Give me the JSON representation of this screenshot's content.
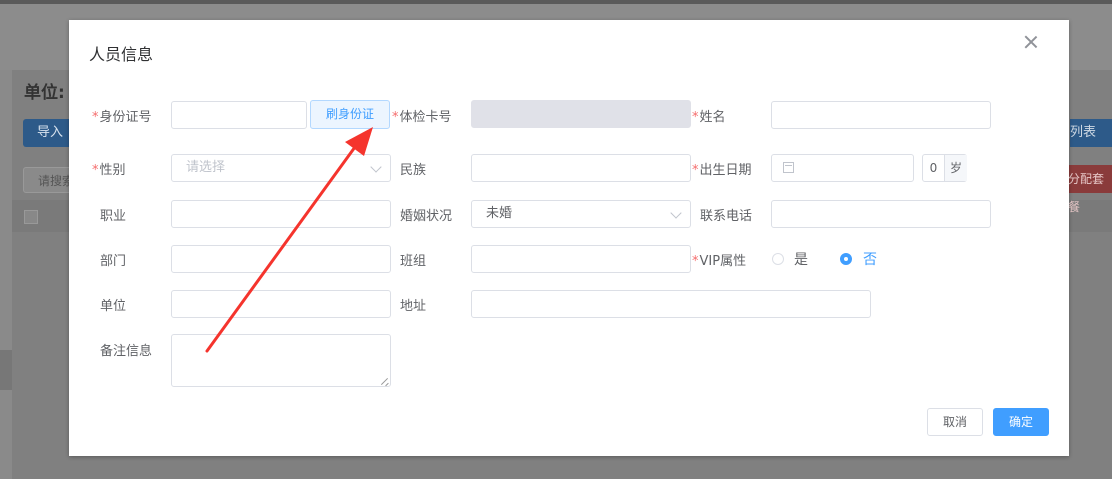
{
  "background": {
    "unit_label": "单位:",
    "import_button": "导入",
    "search_placeholder": "请搜索",
    "right_list_button": "列表",
    "right_red_button": "分配套餐"
  },
  "dialog": {
    "title": "人员信息",
    "fields": {
      "id_number": {
        "label": "身份证号",
        "required": true,
        "value": ""
      },
      "read_id_button": "刷身份证",
      "exam_card": {
        "label": "体检卡号",
        "required": true,
        "value": "",
        "disabled": true
      },
      "name": {
        "label": "姓名",
        "required": true,
        "value": ""
      },
      "gender": {
        "label": "性别",
        "required": true,
        "placeholder": "请选择"
      },
      "ethnicity": {
        "label": "民族",
        "value": ""
      },
      "birth_date": {
        "label": "出生日期",
        "required": true,
        "value": ""
      },
      "age": {
        "value": "0",
        "unit": "岁"
      },
      "occupation": {
        "label": "职业",
        "value": ""
      },
      "marital_status": {
        "label": "婚姻状况",
        "value": "未婚"
      },
      "phone": {
        "label": "联系电话",
        "value": ""
      },
      "department": {
        "label": "部门",
        "value": ""
      },
      "team": {
        "label": "班组",
        "value": ""
      },
      "vip": {
        "label": "VIP属性",
        "required": true,
        "options": [
          "是",
          "否"
        ],
        "selected": "否"
      },
      "unit": {
        "label": "单位",
        "value": ""
      },
      "address": {
        "label": "地址",
        "value": ""
      },
      "remarks": {
        "label": "备注信息",
        "value": ""
      }
    },
    "buttons": {
      "cancel": "取消",
      "confirm": "确定"
    }
  },
  "colors": {
    "primary": "#409eff",
    "required": "#f56c6c",
    "annotation_arrow": "#f5342d"
  }
}
